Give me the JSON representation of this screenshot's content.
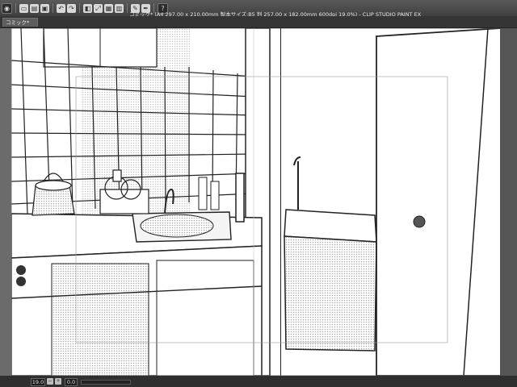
{
  "window": {
    "title": "コミック* (A4 297.00 x 210.00mm 製本サイズ:B5 判 257.00 x 182.00mm 600dpi 19.0%)  - CLIP STUDIO PAINT EX"
  },
  "toolbar": {
    "icons": [
      "app-menu-icon",
      "new-icon",
      "open-icon",
      "save-icon",
      "undo-icon",
      "redo-icon",
      "layer-icon",
      "transform-icon",
      "snap-icon",
      "ruler-icon",
      "brush-icon",
      "pen-icon",
      "help-icon"
    ]
  },
  "tabs": [
    {
      "label": "コミック*"
    }
  ],
  "status": {
    "zoom": "19.0",
    "angle": "0.0"
  },
  "colors": {
    "chrome": "#3c3c3c",
    "titlebar": "#4a4a4a",
    "canvas_bg": "#6b6b6b",
    "paper": "#ffffff"
  }
}
